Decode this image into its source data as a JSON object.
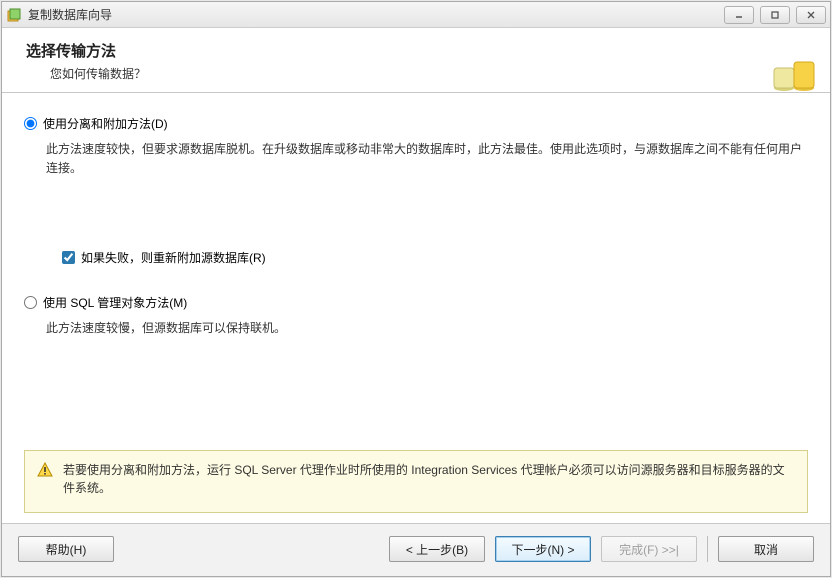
{
  "window": {
    "title": "复制数据库向导"
  },
  "header": {
    "title": "选择传输方法",
    "subtitle": "您如何传输数据？"
  },
  "option1": {
    "label": "使用分离和附加方法(D)",
    "desc": "此方法速度较快，但要求源数据库脱机。在升级数据库或移动非常大的数据库时，此方法最佳。使用此选项时，与源数据库之间不能有任何用户连接。"
  },
  "checkbox": {
    "label": "如果失败，则重新附加源数据库(R)"
  },
  "option2": {
    "label": "使用 SQL 管理对象方法(M)",
    "desc": "此方法速度较慢，但源数据库可以保持联机。"
  },
  "info": {
    "text": "若要使用分离和附加方法，运行 SQL Server 代理作业时所使用的 Integration Services 代理帐户必须可以访问源服务器和目标服务器的文件系统。"
  },
  "buttons": {
    "help": "帮助(H)",
    "back": "< 上一步(B)",
    "next": "下一步(N) >",
    "finish": "完成(F) >>|",
    "cancel": "取消"
  }
}
